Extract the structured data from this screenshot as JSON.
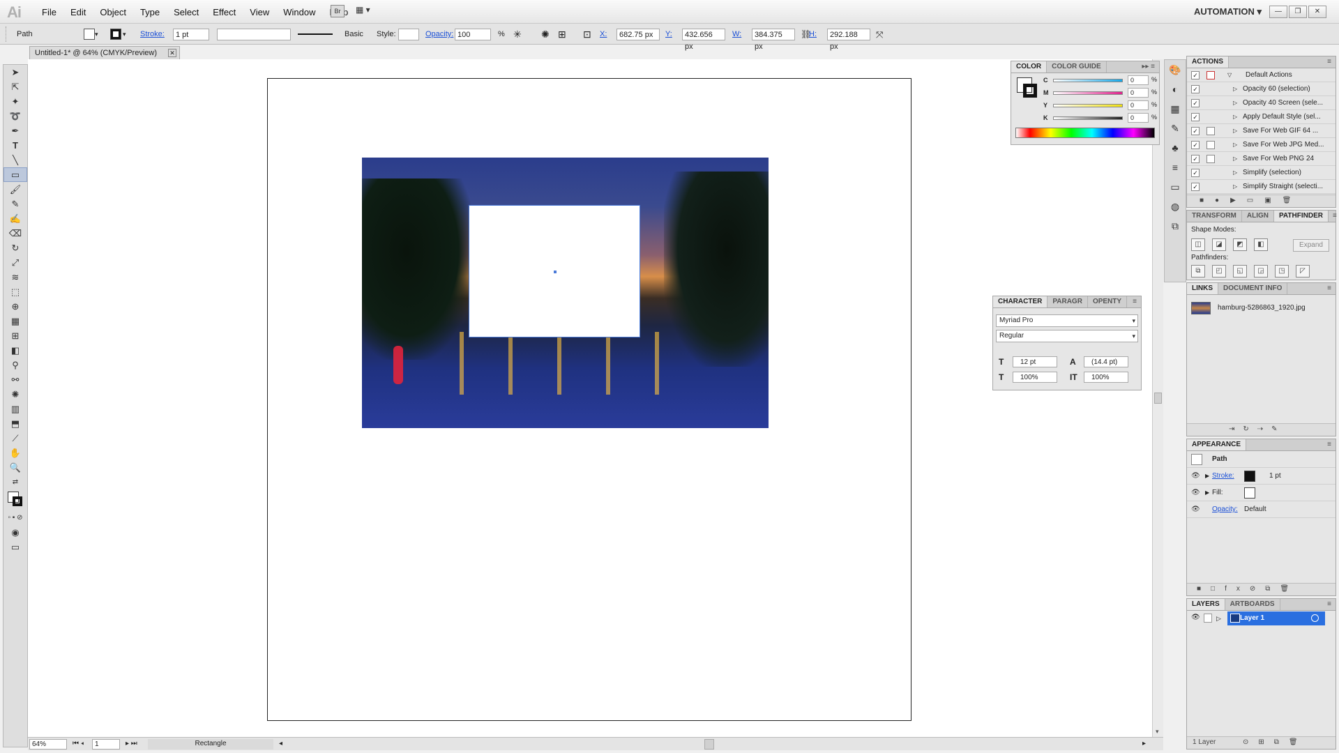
{
  "app": {
    "logo": "Ai",
    "workspace": "AUTOMATION",
    "bridge_label": "Br"
  },
  "menu": [
    "File",
    "Edit",
    "Object",
    "Type",
    "Select",
    "Effect",
    "View",
    "Window",
    "Help"
  ],
  "control": {
    "object_type": "Path",
    "stroke_label": "Stroke:",
    "stroke_value": "1 pt",
    "brush_label": "Basic",
    "style_label": "Style:",
    "opacity_label": "Opacity:",
    "opacity_value": "100",
    "opacity_unit": "%",
    "x_label": "X:",
    "x_value": "682.75 px",
    "y_label": "Y:",
    "y_value": "432.656 px",
    "w_label": "W:",
    "w_value": "384.375 px",
    "h_label": "H:",
    "h_value": "292.188 px"
  },
  "document": {
    "tab_title": "Untitled-1* @ 64% (CMYK/Preview)"
  },
  "status": {
    "zoom": "64%",
    "artboard": "1",
    "tool": "Rectangle"
  },
  "color_panel": {
    "tabs": [
      "COLOR",
      "COLOR GUIDE"
    ],
    "channels": [
      {
        "label": "C",
        "value": "0",
        "color": "#18a8e8"
      },
      {
        "label": "M",
        "value": "0",
        "color": "#e0208c"
      },
      {
        "label": "Y",
        "value": "0",
        "color": "#f0e010"
      },
      {
        "label": "K",
        "value": "0",
        "color": "#222222"
      }
    ],
    "unit": "%"
  },
  "actions_panel": {
    "title": "ACTIONS",
    "folder": "Default Actions",
    "items": [
      "Opacity 60 (selection)",
      "Opacity 40 Screen (sele...",
      "Apply Default Style (sel...",
      "Save For Web GIF 64 ...",
      "Save For Web JPG Med...",
      "Save For Web PNG 24",
      "Simplify (selection)",
      "Simplify Straight (selecti..."
    ]
  },
  "pathfinder_panel": {
    "tabs": [
      "TRANSFORM",
      "ALIGN",
      "PATHFINDER"
    ],
    "shape_modes_label": "Shape Modes:",
    "pathfinders_label": "Pathfinders:",
    "expand_label": "Expand"
  },
  "links_panel": {
    "tabs": [
      "LINKS",
      "DOCUMENT INFO"
    ],
    "file": "hamburg-5286863_1920.jpg"
  },
  "character_panel": {
    "tabs": [
      "CHARACTER",
      "PARAGR",
      "OPENTY"
    ],
    "font": "Myriad Pro",
    "style": "Regular",
    "size": "12 pt",
    "leading": "(14.4 pt)",
    "h_scale": "100%",
    "v_scale": "100%"
  },
  "appearance_panel": {
    "title": "APPEARANCE",
    "object": "Path",
    "stroke_label": "Stroke:",
    "stroke_value": "1 pt",
    "fill_label": "Fill:",
    "opacity_label": "Opacity:",
    "opacity_value": "Default"
  },
  "layers_panel": {
    "tabs": [
      "LAYERS",
      "ARTBOARDS"
    ],
    "layer": "Layer 1",
    "footer": "1 Layer"
  }
}
